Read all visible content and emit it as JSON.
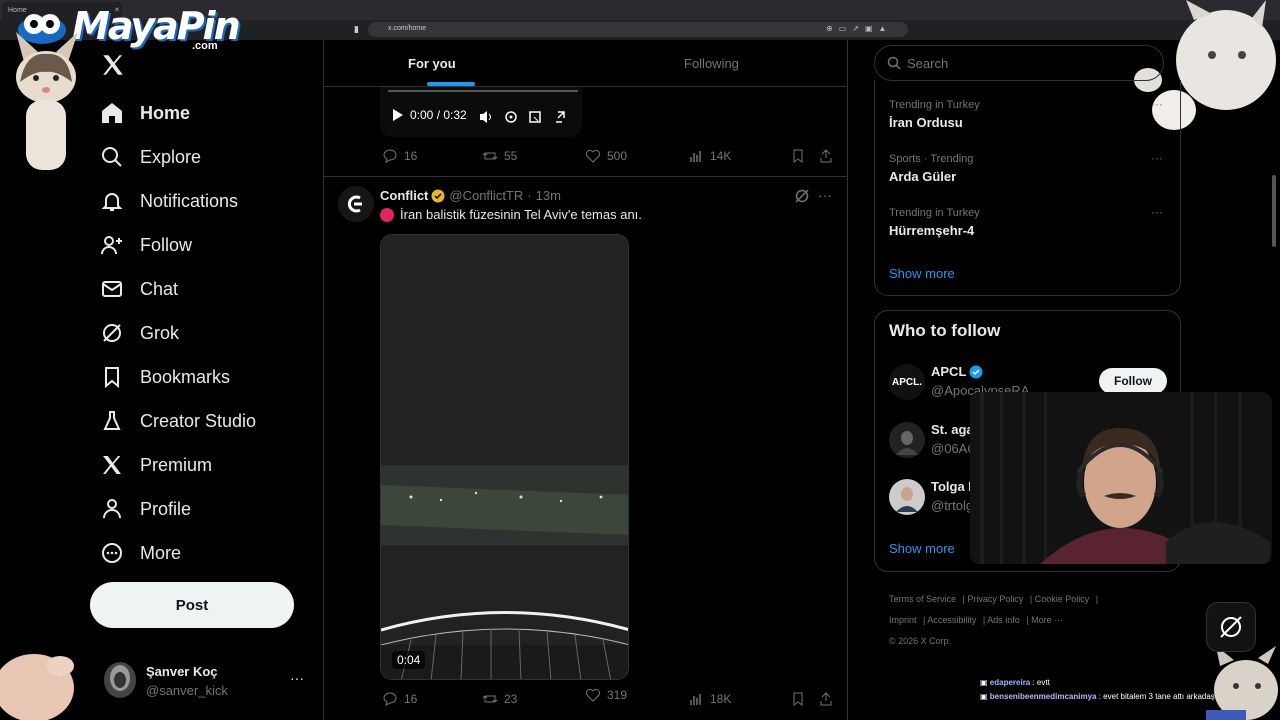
{
  "browser": {
    "tab_title": "Home",
    "url": "x.com/home"
  },
  "overlay": {
    "logo_main": "MayaPin",
    "logo_sub": ".com"
  },
  "nav": {
    "items": [
      {
        "label": "Home",
        "icon": "home-icon"
      },
      {
        "label": "Explore",
        "icon": "search-icon"
      },
      {
        "label": "Notifications",
        "icon": "bell-icon"
      },
      {
        "label": "Follow",
        "icon": "person-plus-icon"
      },
      {
        "label": "Chat",
        "icon": "mail-icon"
      },
      {
        "label": "Grok",
        "icon": "grok-icon"
      },
      {
        "label": "Bookmarks",
        "icon": "bookmark-icon"
      },
      {
        "label": "Creator Studio",
        "icon": "flask-icon"
      },
      {
        "label": "Premium",
        "icon": "x-icon"
      },
      {
        "label": "Profile",
        "icon": "person-icon"
      },
      {
        "label": "More",
        "icon": "more-circle-icon"
      }
    ],
    "post_label": "Post"
  },
  "account": {
    "name": "Şanver Koç",
    "handle": "@sanver_kick"
  },
  "feed": {
    "tabs": {
      "for_you": "For you",
      "following": "Following"
    },
    "prev_tweet": {
      "video_time": "0:00 / 0:32",
      "replies": "16",
      "reposts": "55",
      "likes": "500",
      "views": "14K"
    },
    "tweet": {
      "name": "Conflict",
      "handle": "@ConflictTR",
      "time": "13m",
      "text": "İran balistik füzesinin Tel Aviv'e temas anı.",
      "duration": "0:04",
      "replies": "16",
      "reposts": "23",
      "likes": "319",
      "views": "18K"
    }
  },
  "sidebar": {
    "search_placeholder": "Search",
    "trends": [
      {
        "context": "Trending in Turkey",
        "name": "İran Ordusu"
      },
      {
        "context": "Sports · Trending",
        "name": "Arda Güler"
      },
      {
        "context": "Trending in Turkey",
        "name": "Hürremşehr-4"
      }
    ],
    "show_more": "Show more",
    "who_to_follow": {
      "title": "Who to follow",
      "accounts": [
        {
          "name": "APCL",
          "handle": "@ApocalypseRA",
          "avatar_text": "APCL."
        },
        {
          "name": "St. aga",
          "handle": "@06AC",
          "avatar_text": ""
        },
        {
          "name": "Tolga I",
          "handle": "@trtolg",
          "avatar_text": ""
        }
      ],
      "follow_label": "Follow",
      "show_more": "Show more"
    },
    "footer": {
      "links": [
        "Terms of Service",
        "Privacy Policy",
        "Cookie Policy",
        "Imprint",
        "Accessibility",
        "Ads info",
        "More ···"
      ],
      "copyright": "© 2026 X Corp."
    }
  },
  "chat": {
    "messages": [
      {
        "user": "edapereira",
        "text": ": evtt"
      },
      {
        "user": "bensenibeenmedimcanimya",
        "text": ": evet bitalem 3 tane attı arkadaş"
      }
    ]
  },
  "colors": {
    "accent": "#1d9bf0",
    "background": "#000000",
    "border": "#2f3336",
    "muted": "#71767b",
    "text": "#e7e9ea"
  }
}
